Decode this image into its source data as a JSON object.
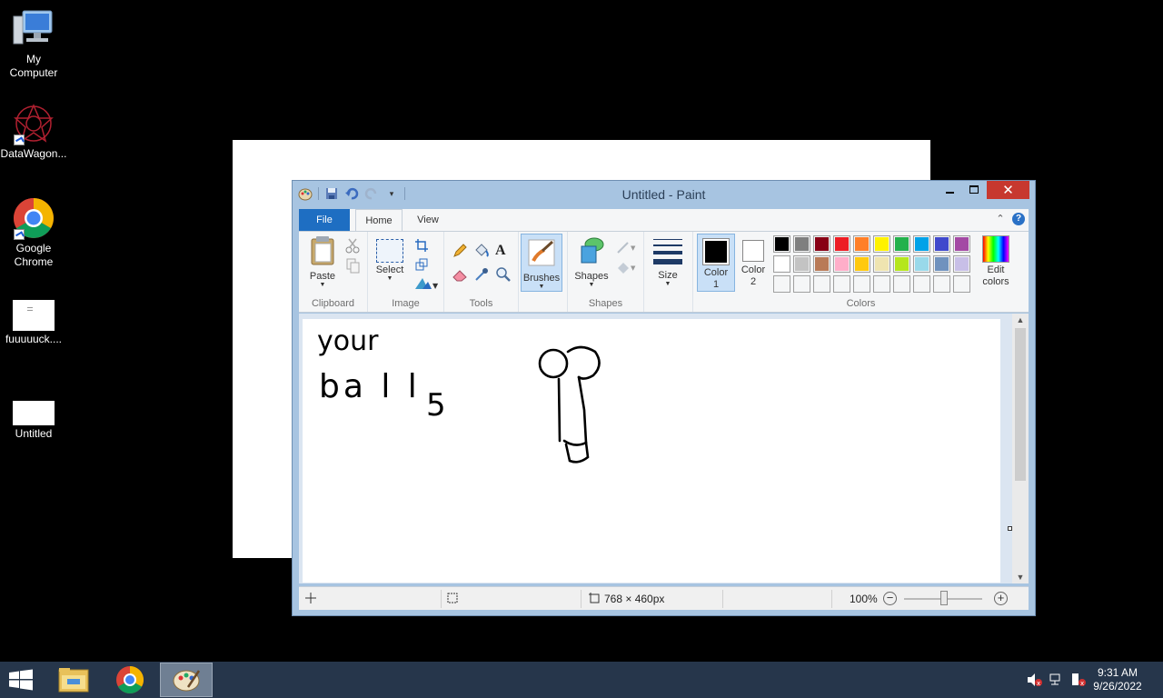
{
  "desktop": {
    "icons": [
      {
        "label_line1": "My",
        "label_line2": "Computer"
      },
      {
        "label_line1": "DataWagon...",
        "label_line2": ""
      },
      {
        "label_line1": "Google",
        "label_line2": "Chrome"
      },
      {
        "label_line1": "fuuuuuck....",
        "label_line2": ""
      },
      {
        "label_line1": "Untitled",
        "label_line2": ""
      }
    ]
  },
  "paint": {
    "title": "Untitled - Paint",
    "tabs": {
      "file": "File",
      "home": "Home",
      "view": "View"
    },
    "help_glyph": "?",
    "groups": {
      "clipboard": {
        "label": "Clipboard",
        "paste": "Paste"
      },
      "image": {
        "label": "Image",
        "select": "Select"
      },
      "tools": {
        "label": "Tools"
      },
      "brushes": {
        "label": "Brushes"
      },
      "shapes": {
        "label": "Shapes",
        "shapes_btn": "Shapes"
      },
      "size": {
        "label": "Size"
      },
      "color1": {
        "line1": "Color",
        "line2": "1"
      },
      "color2": {
        "line1": "Color",
        "line2": "2"
      },
      "colors": {
        "label": "Colors"
      },
      "edit_colors": {
        "line1": "Edit",
        "line2": "colors"
      }
    },
    "palette_row1": [
      "#000000",
      "#7f7f7f",
      "#880015",
      "#ed1c24",
      "#ff7f27",
      "#fff200",
      "#22b14c",
      "#00a2e8",
      "#3f48cc",
      "#a349a4"
    ],
    "palette_row2": [
      "#ffffff",
      "#c3c3c3",
      "#b97a57",
      "#ffaec9",
      "#ffc90e",
      "#efe4b0",
      "#b5e61d",
      "#99d9ea",
      "#7092be",
      "#c8bfe7"
    ],
    "color1_value": "#000000",
    "color2_value": "#ffffff",
    "canvas_text": {
      "line1": "your",
      "line2": "ba l l",
      "line3": "5"
    },
    "status": {
      "dimensions": "768 × 460px",
      "zoom": "100%"
    }
  },
  "taskbar": {
    "time": "9:31 AM",
    "date": "9/26/2022"
  }
}
